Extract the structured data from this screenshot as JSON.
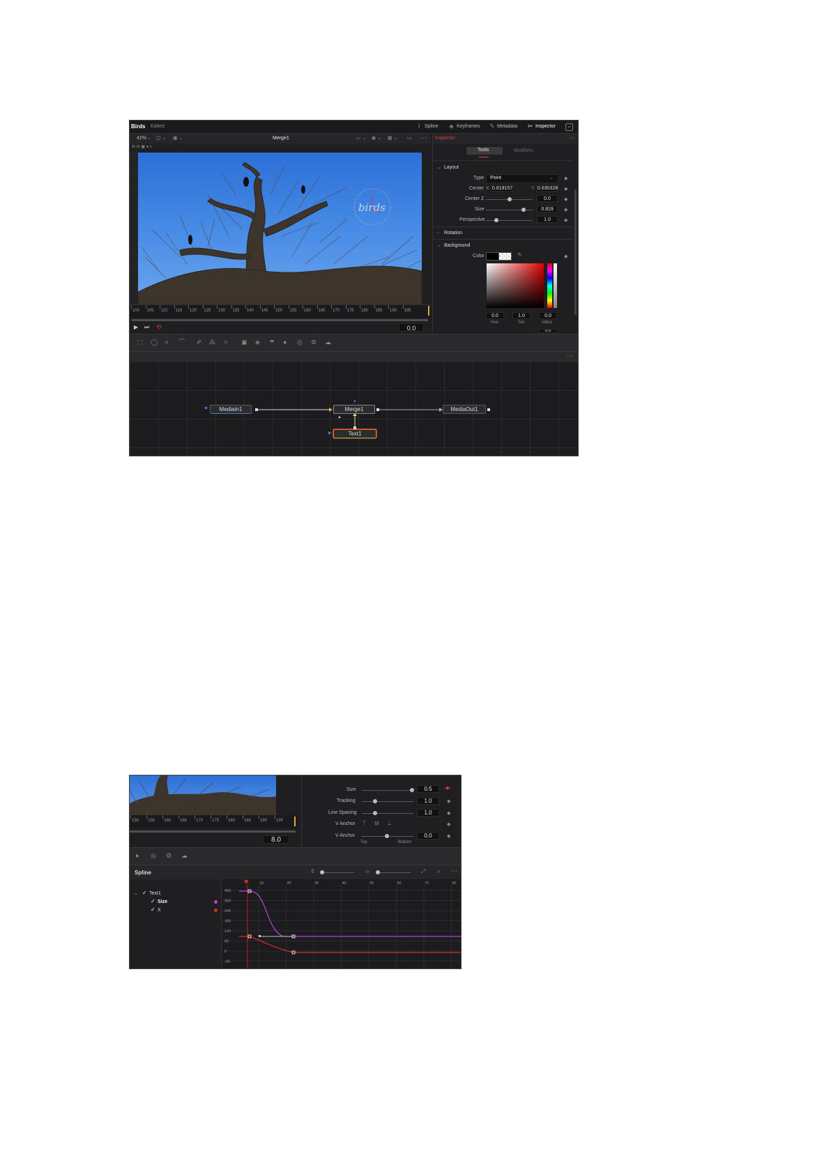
{
  "top": {
    "title_bar": {
      "app_title": "Birds",
      "status": "Edited",
      "tabs": [
        {
          "label": "Spline",
          "icon": "spline-icon"
        },
        {
          "label": "Keyframes",
          "icon": "keyframes-icon"
        },
        {
          "label": "Metadata",
          "icon": "metadata-icon"
        },
        {
          "label": "Inspector",
          "icon": "inspector-icon"
        }
      ]
    },
    "viewer": {
      "zoom": "42%",
      "node_title": "Merge1",
      "timecode": "0.0",
      "ruler_ticks": [
        "100",
        "105",
        "110",
        "115",
        "120",
        "125",
        "130",
        "135",
        "140",
        "145",
        "150",
        "155",
        "160",
        "165",
        "170",
        "175",
        "180",
        "185",
        "190",
        "195"
      ],
      "overlay_text": "birds"
    },
    "inspector": {
      "title": "Inspector",
      "tabs": [
        "Tools",
        "Modifiers"
      ],
      "layout_section": "Layout",
      "type_label": "Type",
      "type_value": "Point",
      "center_label": "Center",
      "center_x_label": "X",
      "center_x": "0.819157",
      "center_y_label": "Y",
      "center_y": "0.630328",
      "center_z_label": "Center Z",
      "center_z": "0.0",
      "size_label": "Size",
      "size_value": "0.819",
      "perspective_label": "Perspective",
      "perspective_value": "1.0",
      "rotation_section": "Rotation",
      "background_section": "Background",
      "color_label": "Color",
      "hue_label": "Hue",
      "hue_value": "0.0",
      "sat_label": "Sat",
      "sat_value": "1.0",
      "value_label": "Value",
      "value_value": "0.0",
      "partial_value": "0.0"
    },
    "nodes": [
      {
        "label": "MediaIn1",
        "color": "#4a7fd0"
      },
      {
        "label": "Merge1",
        "color": "#c8c8c8"
      },
      {
        "label": "MediaOut1",
        "color": "#c8c8c8"
      },
      {
        "label": "Text1",
        "color": "#4caf50"
      }
    ]
  },
  "bottom": {
    "timecode": "8.0",
    "ruler_ticks": [
      "150",
      "155",
      "160",
      "165",
      "170",
      "175",
      "180",
      "185",
      "190",
      "195"
    ],
    "inspector_rows": [
      {
        "label": "Size",
        "value": "0.5"
      },
      {
        "label": "Tracking",
        "value": "1.0"
      },
      {
        "label": "Line Spacing",
        "value": "1.0"
      },
      {
        "label": "V Anchor",
        "value": ""
      },
      {
        "label": "V Anchor",
        "value": "0.0"
      }
    ],
    "anchor_sub_labels": [
      "Top",
      "Bottom"
    ],
    "spline": {
      "title": "Spline",
      "tree": [
        {
          "label": "Text1",
          "checked": true
        },
        {
          "label": "Size",
          "checked": true,
          "color": "#c03ee0"
        },
        {
          "label": "X",
          "checked": true,
          "color": "#e02a2a"
        }
      ],
      "frame_ticks": [
        "10",
        "20",
        "30",
        "40",
        "50",
        "60",
        "70",
        "80"
      ],
      "value_ticks": [
        "400",
        "300",
        "240",
        "180",
        "120",
        "60",
        "0",
        "-60"
      ]
    }
  },
  "colors": {
    "accent_red": "#e0403a",
    "panel_bg": "#1f1f21",
    "curve_size": "#c03ee0",
    "curve_x": "#e02a2a"
  }
}
